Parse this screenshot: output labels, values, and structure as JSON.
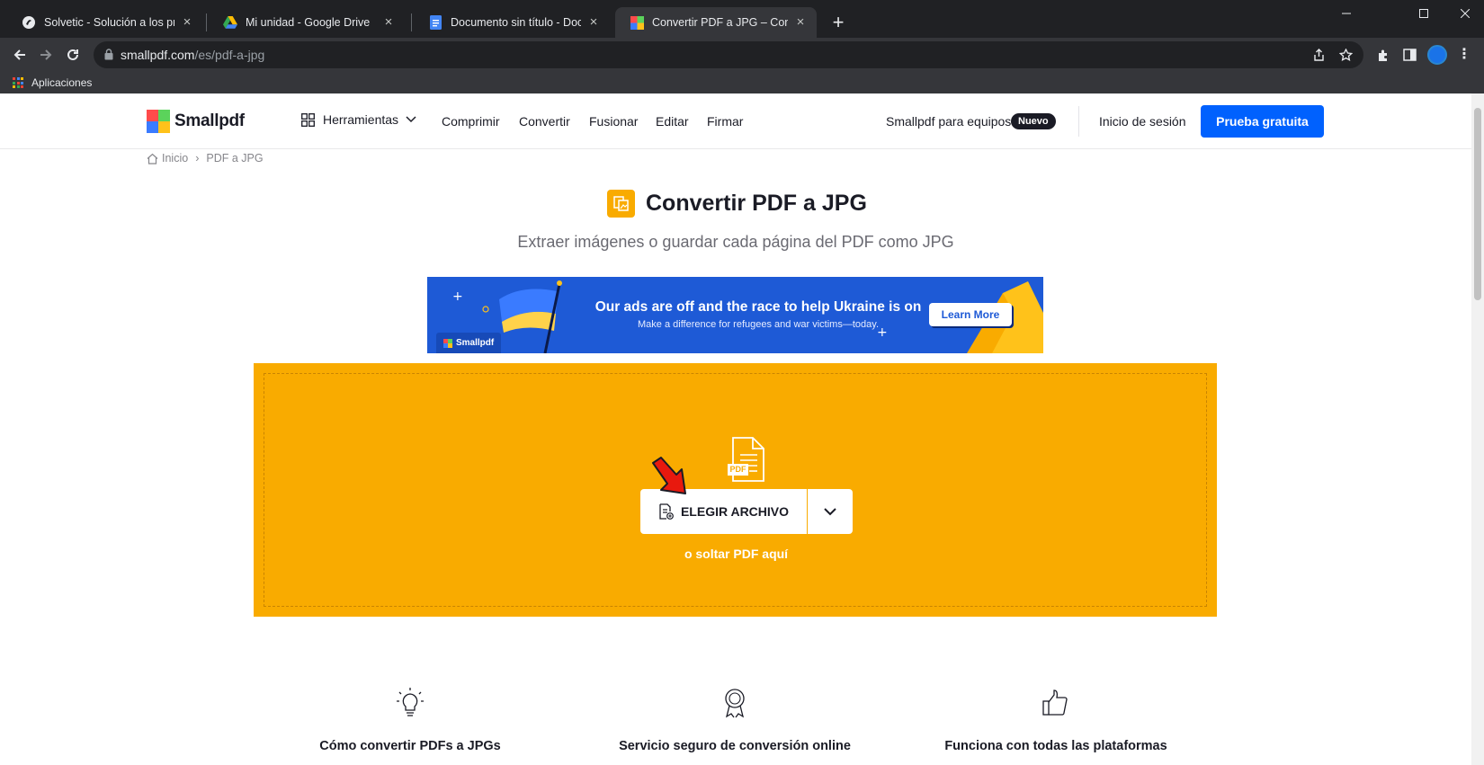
{
  "browser": {
    "tabs": [
      {
        "title": "Solvetic - Solución a los problemas",
        "active": false
      },
      {
        "title": "Mi unidad - Google Drive",
        "active": false
      },
      {
        "title": "Documento sin título - Documentos",
        "active": false
      },
      {
        "title": "Convertir PDF a JPG – Convierte de",
        "active": true
      }
    ],
    "new_tab_symbol": "+",
    "url_host": "smallpdf.com",
    "url_path": "/es/pdf-a-jpg",
    "bookmark_apps_label": "Aplicaciones",
    "accent_color": "#1a73e8"
  },
  "header": {
    "logo_text": "Smallpdf",
    "tools_label": "Herramientas",
    "nav": [
      "Comprimir",
      "Convertir",
      "Fusionar",
      "Editar",
      "Firmar"
    ],
    "teams_label": "Smallpdf para equipos",
    "new_badge": "Nuevo",
    "login_label": "Inicio de sesión",
    "trial_button": "Prueba gratuita",
    "brand_color": "#0061fe"
  },
  "breadcrumb": {
    "home": "Inicio",
    "current": "PDF a JPG"
  },
  "main": {
    "title": "Convertir PDF a JPG",
    "subtitle": "Extraer imágenes o guardar cada página del PDF como JPG",
    "tool_color": "#f9ab00"
  },
  "banner": {
    "headline": "Our ads are off and the race to help Ukraine is on",
    "subline": "Make a difference for refugees and war victims—today.",
    "button": "Learn More",
    "logo_text": "Smallpdf"
  },
  "dropzone": {
    "file_badge": "PDF",
    "choose_button": "ELEGIR ARCHIVO",
    "drop_hint": "o soltar PDF aquí"
  },
  "features": [
    {
      "icon": "lightbulb-icon",
      "title": "Cómo convertir PDFs a JPGs"
    },
    {
      "icon": "award-ribbon-icon",
      "title": "Servicio seguro de conversión online"
    },
    {
      "icon": "thumbs-up-icon",
      "title": "Funciona con todas las plataformas"
    }
  ]
}
